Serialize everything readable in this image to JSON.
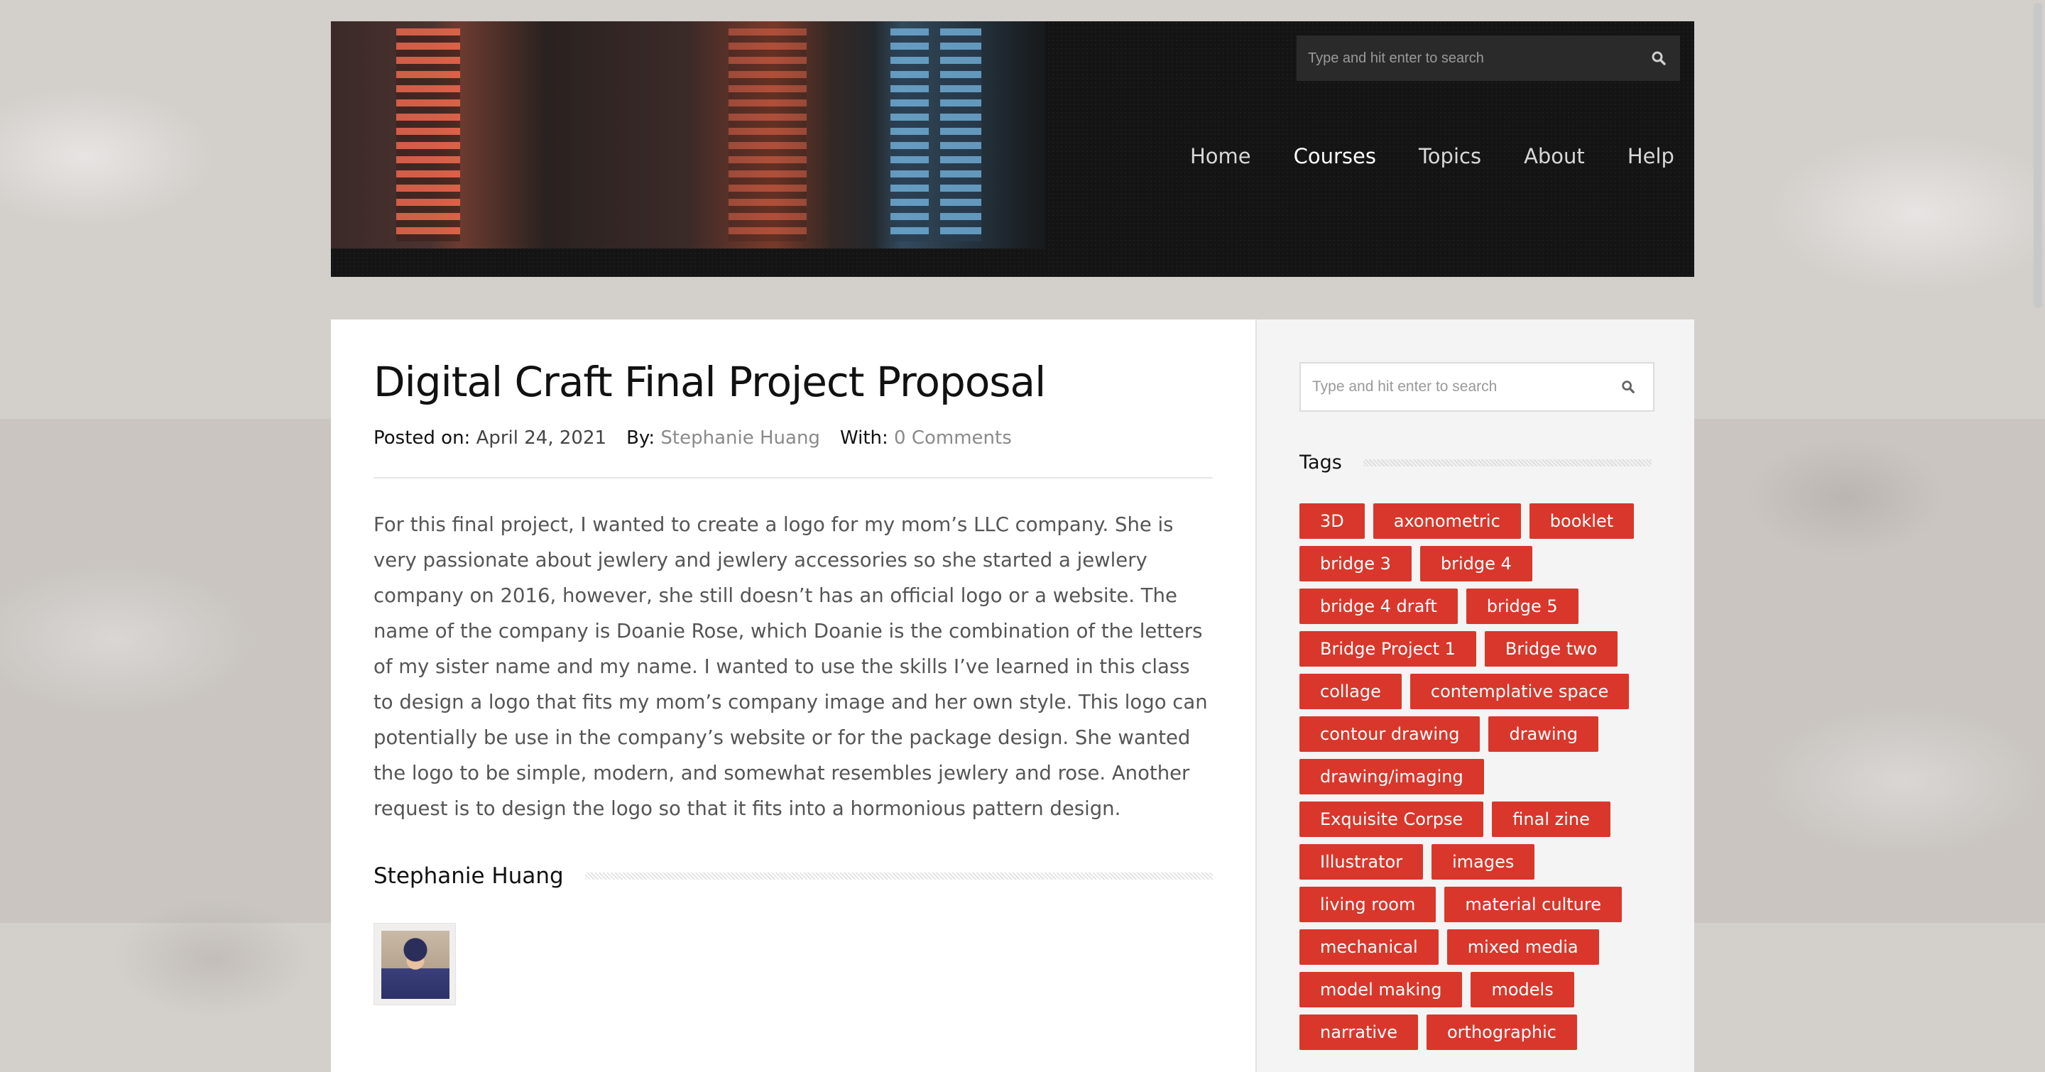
{
  "header": {
    "search_placeholder": "Type and hit enter to search",
    "nav": [
      {
        "label": "Home",
        "active": false
      },
      {
        "label": "Courses",
        "active": true
      },
      {
        "label": "Topics",
        "active": false
      },
      {
        "label": "About",
        "active": false
      },
      {
        "label": "Help",
        "active": false
      }
    ]
  },
  "post": {
    "title": "Digital Craft Final Project Proposal",
    "posted_label": "Posted on:",
    "posted_date": "April 24, 2021",
    "by_label": "By:",
    "author": "Stephanie Huang",
    "with_label": "With:",
    "comments": "0 Comments",
    "body": "For this final project, I wanted to create a logo for my mom’s LLC company. She is very passionate about jewlery and jewlery accessories so she started a jewlery company on 2016, however, she still doesn’t has an official logo or a website. The name of the company is Doanie Rose, which Doanie is the combination of the letters of my sister name and my name. I wanted to use the skills I’ve learned in this class to design a logo that fits my mom’s company image and her own style. This logo can potentially be use in the company’s website or for the package design. She wanted the logo to be simple, modern, and somewhat resembles jewlery and rose. Another request is to design the logo so that it fits into a hormonious pattern design.",
    "author_box_name": "Stephanie Huang"
  },
  "sidebar": {
    "search_placeholder": "Type and hit enter to search",
    "tags_title": "Tags",
    "tags": [
      "3D",
      "axonometric",
      "booklet",
      "bridge 3",
      "bridge 4",
      "bridge 4 draft",
      "bridge 5",
      "Bridge Project 1",
      "Bridge two",
      "collage",
      "contemplative space",
      "contour drawing",
      "drawing",
      "drawing/imaging",
      "Exquisite Corpse",
      "final zine",
      "Illustrator",
      "images",
      "living room",
      "material culture",
      "mechanical",
      "mixed media",
      "model making",
      "models",
      "narrative",
      "orthographic"
    ]
  },
  "colors": {
    "tag_bg": "#d9372b",
    "header_bg": "#141414",
    "page_bg": "#d3cfcb"
  }
}
